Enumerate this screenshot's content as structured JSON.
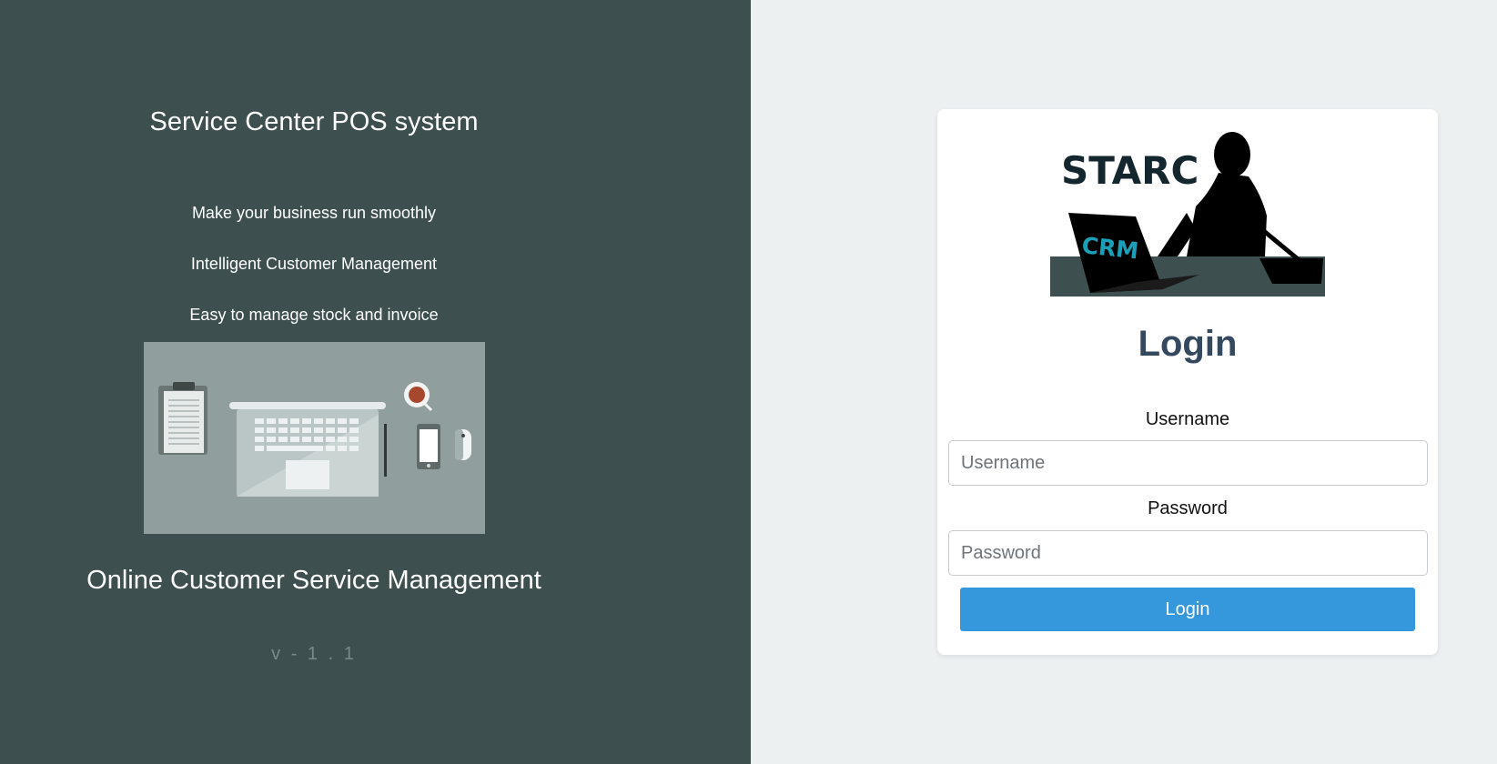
{
  "left_panel": {
    "title": "Service Center POS system",
    "taglines": [
      "Make your business run smoothly",
      "Intelligent Customer Management",
      "Easy to manage stock and invoice"
    ],
    "subtitle": "Online Customer Service Management",
    "version": "v - 1 . 1",
    "background_color": "#3d4f4e"
  },
  "login_card": {
    "logo": {
      "brand_text": "STARC",
      "badge_text": "CRM"
    },
    "heading": "Login",
    "username": {
      "label": "Username",
      "placeholder": "Username",
      "value": ""
    },
    "password": {
      "label": "Password",
      "placeholder": "Password",
      "value": ""
    },
    "submit_label": "Login",
    "accent_color": "#3598dc",
    "heading_color": "#34495e"
  }
}
